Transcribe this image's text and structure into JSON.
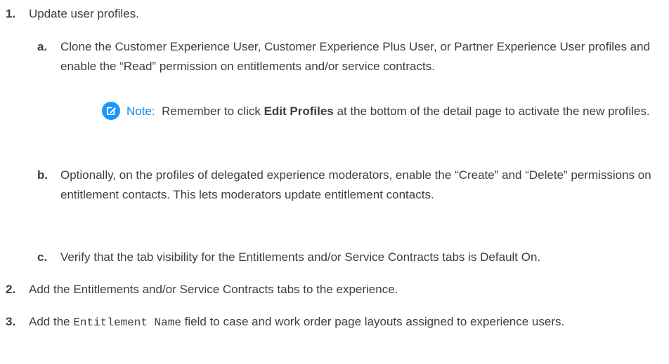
{
  "steps": [
    {
      "number": "1.",
      "text": "Update user profiles.",
      "substeps": [
        {
          "letter": "a.",
          "text": "Clone the Customer Experience User, Customer Experience Plus User, or Partner Experience User profiles and enable the “Read” permission on entitlements and/or service contracts.",
          "note": {
            "icon": "edit-note-icon",
            "label": "Note:",
            "before": "Remember to click ",
            "bold": "Edit Profiles",
            "after": " at the bottom of the detail page to activate the new profiles."
          }
        },
        {
          "letter": "b.",
          "text": "Optionally, on the profiles of delegated experience moderators, enable the “Create” and “Delete” permissions on entitlement contacts. This lets moderators update entitlement contacts."
        },
        {
          "letter": "c.",
          "text": "Verify that the tab visibility for the Entitlements and/or Service Contracts tabs is Default On."
        }
      ]
    },
    {
      "number": "2.",
      "text": "Add the Entitlements and/or Service Contracts tabs to the experience."
    },
    {
      "number": "3.",
      "before": "Add the ",
      "code": "Entitlement Name",
      "after": " field to case and work order page layouts assigned to experience users."
    }
  ],
  "colors": {
    "text": "#3e3e3c",
    "note_label": "#0b8ae6",
    "note_icon_bg": "#1b96ff"
  }
}
